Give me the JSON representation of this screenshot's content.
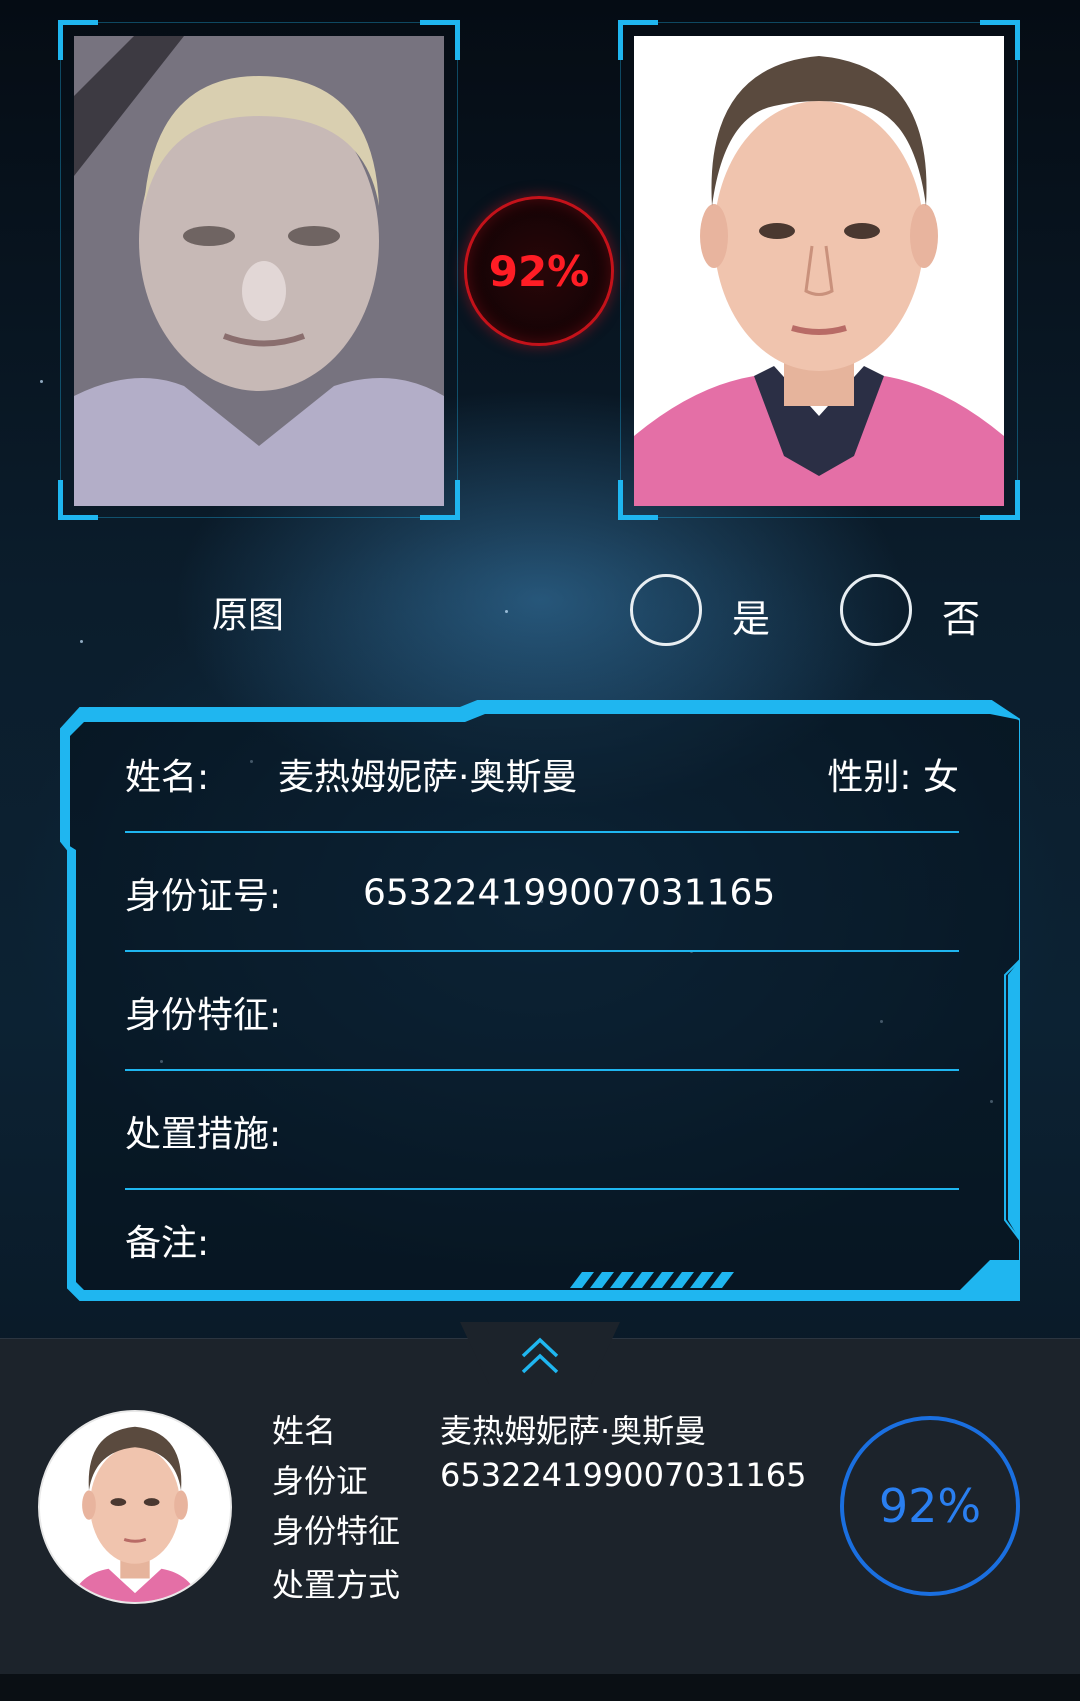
{
  "comparison": {
    "score": "92%"
  },
  "labels": {
    "original": "原图",
    "yes": "是",
    "no": "否"
  },
  "info": {
    "name_label": "姓名:",
    "name_value": "麦热姆妮萨·奥斯曼",
    "gender": "性别: 女",
    "id_label": "身份证号:",
    "id_value": "653224199007031165",
    "features_label": "身份特征:",
    "measures_label": "处置措施:",
    "notes_label": "备注:"
  },
  "sheet": {
    "name_label": "姓名",
    "name_value": "麦热姆妮萨·奥斯曼",
    "id_label": "身份证",
    "id_value": "653224199007031165",
    "features_label": "身份特征",
    "method_label": "处置方式",
    "score": "92%"
  },
  "icons": {
    "expand": "chevron-up-icon"
  },
  "colors": {
    "accent": "#1fb6f0",
    "score_red": "#ff1d25",
    "score_blue": "#2a7ff0"
  }
}
